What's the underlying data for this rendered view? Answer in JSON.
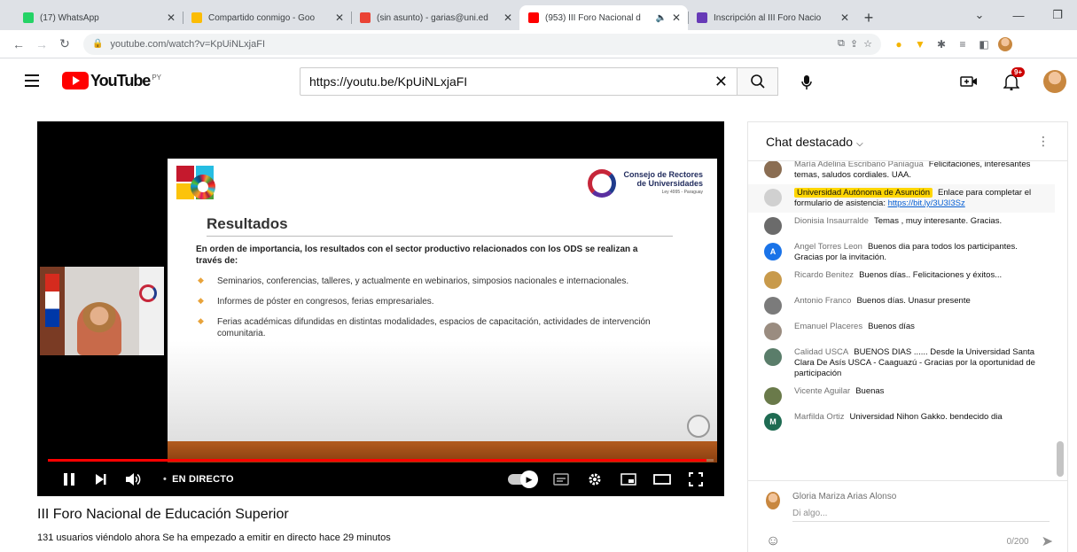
{
  "browser": {
    "tabs": [
      {
        "title": "(17) WhatsApp",
        "favicon_color": "#25d366",
        "active": false,
        "muted_icon": false
      },
      {
        "title": "Compartido conmigo - Goo",
        "favicon_color": "#fbbc04",
        "active": false,
        "muted_icon": false
      },
      {
        "title": "(sin asunto) - garias@uni.ed",
        "favicon_color": "#ea4335",
        "active": false,
        "muted_icon": false
      },
      {
        "title": "(953) III Foro Nacional d",
        "favicon_color": "#ff0000",
        "active": true,
        "muted_icon": true
      },
      {
        "title": "Inscripción al III Foro Nacio",
        "favicon_color": "#673ab7",
        "active": false,
        "muted_icon": false
      }
    ],
    "url": "youtube.com/watch?v=KpUiNLxjaFI"
  },
  "youtube": {
    "logo_text": "YouTube",
    "country_code": "PY",
    "search_value": "https://youtu.be/KpUiNLxjaFI",
    "notification_count": "9+"
  },
  "slide": {
    "heading": "Resultados",
    "org_name_line1": "Consejo de Rectores",
    "org_name_line2": "de Universidades",
    "org_sub": "Ley 4995 - Paraguay",
    "lead": "En orden de importancia, los resultados con el sector productivo relacionados con los ODS se realizan a través de:",
    "bullets": [
      "Seminarios, conferencias, talleres, y actualmente en webinarios, simposios nacionales e internacionales.",
      "Informes de póster en congresos, ferias empresariales.",
      "Ferias académicas difundidas en distintas modalidades, espacios de capacitación, actividades de intervención comunitaria."
    ]
  },
  "player": {
    "live_label": "EN DIRECTO",
    "progress": 0.99
  },
  "video": {
    "title": "III Foro Nacional de Educación Superior",
    "info": "131 usuarios viéndolo ahora  Se ha empezado a emitir en directo hace 29 minutos"
  },
  "chat": {
    "header": "Chat destacado",
    "messages": [
      {
        "author": "María Adelina Escribano Paniagua",
        "text": "Felicitaciones, interesantes temas, saludos cordiales. UAA.",
        "avatar_color": "#8a6d52",
        "initial": "",
        "owner": false,
        "link": ""
      },
      {
        "author": "Universidad Autónoma de Asunción",
        "text": "Enlace para completar el formulario de asistencia:",
        "avatar_color": "#d0d0d0",
        "initial": "",
        "owner": true,
        "link": "https://bit.ly/3U3I3Sz"
      },
      {
        "author": "Dionisia Insaurralde",
        "text": "Temas , muy interesante. Gracias.",
        "avatar_color": "#6b6b6b",
        "initial": "",
        "owner": false,
        "link": ""
      },
      {
        "author": "Angel Torres Leon",
        "text": "Buenos dia para todos los participantes. Gracias por la invitación.",
        "avatar_color": "#1a73e8",
        "initial": "A",
        "owner": false,
        "link": ""
      },
      {
        "author": "Ricardo Benitez",
        "text": "Buenos días.. Felicitaciones y éxitos...",
        "avatar_color": "#c89a4b",
        "initial": "",
        "owner": false,
        "link": ""
      },
      {
        "author": "Antonio Franco",
        "text": "Buenos días. Unasur presente",
        "avatar_color": "#7b7b7b",
        "initial": "",
        "owner": false,
        "link": ""
      },
      {
        "author": "Emanuel Placeres",
        "text": "Buenos días",
        "avatar_color": "#9a8c80",
        "initial": "",
        "owner": false,
        "link": ""
      },
      {
        "author": "Calidad USCA",
        "text": "BUENOS DIAS ...... Desde la Universidad Santa Clara De Asís USCA - Caaguazú - Gracias por la oportunidad de participación",
        "avatar_color": "#5a7d6a",
        "initial": "",
        "owner": false,
        "link": ""
      },
      {
        "author": "Vicente Aguilar",
        "text": "Buenas",
        "avatar_color": "#6a7a4a",
        "initial": "",
        "owner": false,
        "link": ""
      },
      {
        "author": "Marfilda Ortiz",
        "text": "Universidad Nihon Gakko. bendecido dia",
        "avatar_color": "#1e6b52",
        "initial": "M",
        "owner": false,
        "link": ""
      }
    ],
    "input": {
      "user_name": "Gloria Mariza Arias Alonso",
      "placeholder": "Di algo...",
      "char_count": "0/200"
    }
  }
}
